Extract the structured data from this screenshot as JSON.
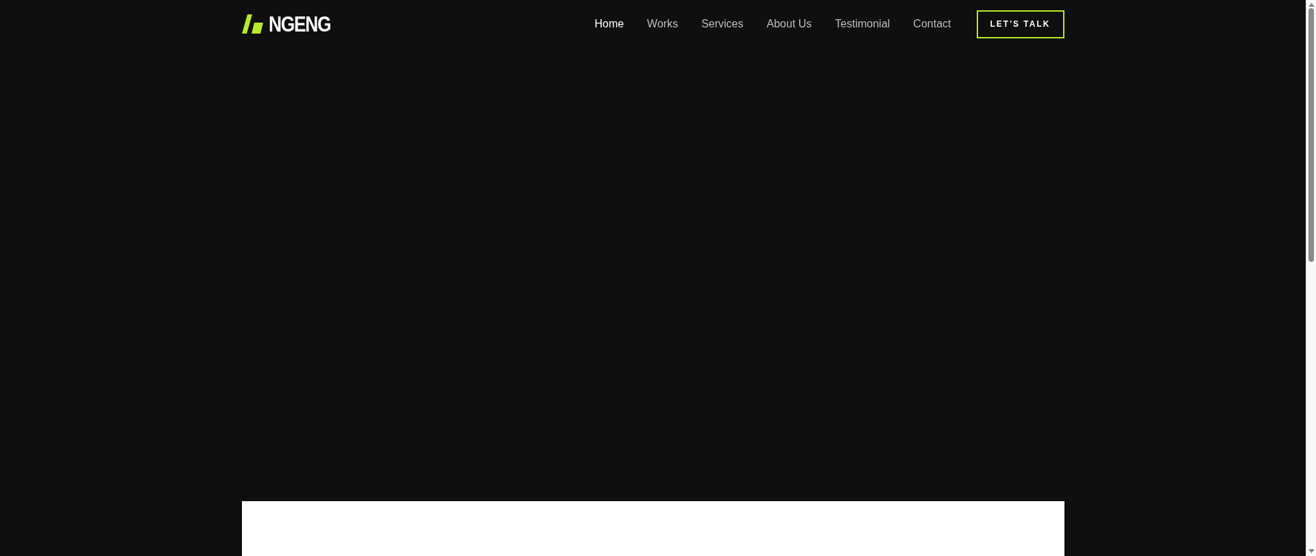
{
  "brand": {
    "name": "NGENG"
  },
  "nav": [
    {
      "label": "Home",
      "selected": true
    },
    {
      "label": "Works",
      "selected": false
    },
    {
      "label": "Services",
      "selected": false
    },
    {
      "label": "About Us",
      "selected": false
    },
    {
      "label": "Testimonial",
      "selected": false
    },
    {
      "label": "Contact",
      "selected": false
    }
  ],
  "cta_button": {
    "label": "LET'S TALK"
  }
}
